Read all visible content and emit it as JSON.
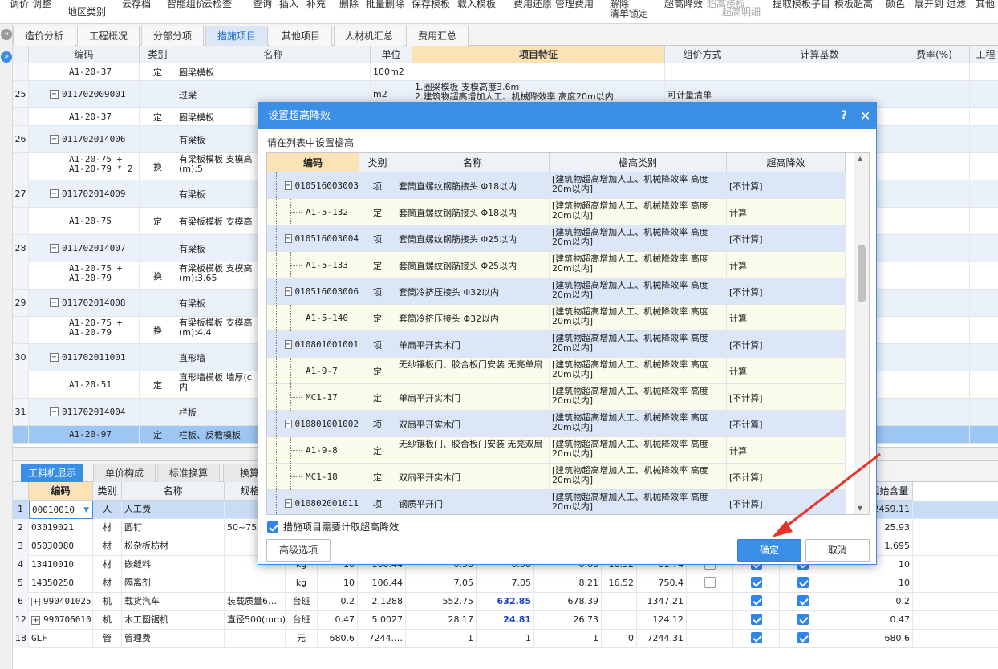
{
  "ribbon": {
    "items": [
      "调价",
      "调整",
      "地区类别",
      "云存档",
      "智能组价",
      "云检查",
      "查询",
      "插入",
      "补充",
      "删除",
      "批量删除",
      "保存模板",
      "载入模板",
      "费用还原",
      "管理费用",
      "解除",
      "清单锁定",
      "超高降效",
      "超高模板",
      "超高明细",
      "提取模板子目",
      "模板超高",
      "颜色",
      "展开到",
      "过滤",
      "其他"
    ]
  },
  "tabs": [
    "造价分析",
    "工程概况",
    "分部分项",
    "措施项目",
    "其他项目",
    "人材机汇总",
    "费用汇总"
  ],
  "activeTab": "措施项目",
  "grid": {
    "headers": [
      "编码",
      "类别",
      "名称",
      "单位",
      "项目特征",
      "组价方式",
      "计算基数",
      "费率(%)",
      "工程"
    ],
    "rows": [
      {
        "no": "",
        "code": "A1-20-37",
        "type": "定",
        "name": "圈梁模板",
        "unit": "100m2",
        "feature": "",
        "method": "",
        "level": "child"
      },
      {
        "no": "25",
        "code": "011702009001",
        "type": "",
        "name": "过梁",
        "unit": "m2",
        "feature": "1.圈梁模板 支模高度3.6m\n2.建筑物超高增加人工、机械降效率 高度20m以内",
        "method": "可计量清单",
        "level": "parent"
      },
      {
        "no": "",
        "code": "A1-20-37",
        "type": "定",
        "name": "圈梁模板",
        "unit": "",
        "feature": "",
        "method": "",
        "level": "child"
      },
      {
        "no": "26",
        "code": "011702014006",
        "type": "",
        "name": "有梁板",
        "unit": "",
        "feature": "",
        "method": "",
        "level": "parent"
      },
      {
        "no": "",
        "code": "A1-20-75 +\nA1-20-79 * 2",
        "type": "换",
        "name": "有梁板模板 支模高\n(m):5",
        "unit": "",
        "feature": "",
        "method": "",
        "level": "child"
      },
      {
        "no": "27",
        "code": "011702014009",
        "type": "",
        "name": "有梁板",
        "unit": "",
        "feature": "",
        "method": "",
        "level": "parent"
      },
      {
        "no": "",
        "code": "A1-20-75",
        "type": "定",
        "name": "有梁板模板 支模高",
        "unit": "",
        "feature": "",
        "method": "",
        "level": "child"
      },
      {
        "no": "28",
        "code": "011702014007",
        "type": "",
        "name": "有梁板",
        "unit": "",
        "feature": "",
        "method": "",
        "level": "parent"
      },
      {
        "no": "",
        "code": "A1-20-75 +\nA1-20-79",
        "type": "换",
        "name": "有梁板模板 支模高\n(m):3.65",
        "unit": "",
        "feature": "",
        "method": "",
        "level": "child"
      },
      {
        "no": "29",
        "code": "011702014008",
        "type": "",
        "name": "有梁板",
        "unit": "",
        "feature": "",
        "method": "",
        "level": "parent"
      },
      {
        "no": "",
        "code": "A1-20-75 +\nA1-20-79",
        "type": "换",
        "name": "有梁板模板 支模高\n(m):4.4",
        "unit": "",
        "feature": "",
        "method": "",
        "level": "child"
      },
      {
        "no": "30",
        "code": "011702011001",
        "type": "",
        "name": "直形墙",
        "unit": "",
        "feature": "",
        "method": "",
        "level": "parent"
      },
      {
        "no": "",
        "code": "A1-20-51",
        "type": "定",
        "name": "直形墙模板 墙厚(c\n内",
        "unit": "",
        "feature": "",
        "method": "",
        "level": "child"
      },
      {
        "no": "31",
        "code": "011702014004",
        "type": "",
        "name": "栏板",
        "unit": "",
        "feature": "",
        "method": "",
        "level": "parent"
      },
      {
        "no": "",
        "code": "A1-20-97",
        "type": "定",
        "name": "栏板、反檐模板",
        "unit": "",
        "feature": "",
        "method": "",
        "level": "selected"
      }
    ]
  },
  "bottomTabs": [
    "工料机显示",
    "单价构成",
    "标准换算",
    "换算信"
  ],
  "bottomGrid": {
    "headers": [
      "编码",
      "类别",
      "名称",
      "规格及",
      "",
      "",
      "",
      "",
      "",
      "",
      "",
      "",
      "",
      "",
      "",
      "规始含量"
    ],
    "rows": [
      {
        "no": "1",
        "code": "00010010",
        "type": "人",
        "name": "人工费",
        "spec": "",
        "unit": "",
        "q": "",
        "a": "",
        "p1": "",
        "p2": "",
        "p3": "",
        "p4": "",
        "p5": "",
        "c1": false,
        "c2": false,
        "c3": false,
        "last": "2459.11",
        "sel": true
      },
      {
        "no": "2",
        "code": "03019021",
        "type": "材",
        "name": "圆钉",
        "spec": "50~75",
        "unit": "",
        "q": "",
        "a": "",
        "p1": "",
        "p2": "",
        "p3": "",
        "p4": "",
        "p5": "",
        "c1": false,
        "c2": false,
        "c3": false,
        "last": "25.93"
      },
      {
        "no": "3",
        "code": "05030080",
        "type": "材",
        "name": "松杂板枋材",
        "spec": "",
        "unit": "",
        "q": "",
        "a": "",
        "p1": "",
        "p2": "",
        "p3": "",
        "p4": "",
        "p5": "",
        "c1": false,
        "c2": false,
        "c3": false,
        "last": "1.695"
      },
      {
        "no": "4",
        "code": "13410010",
        "type": "材",
        "name": "嵌缝料",
        "spec": "",
        "unit": "kg",
        "q": "10",
        "a": "106.44",
        "p1": "0.58",
        "p2": "0.58",
        "p3": "0.68",
        "p4": "16.52",
        "p5": "61.74",
        "c1": true,
        "c2": true,
        "c3": true,
        "last": "10"
      },
      {
        "no": "5",
        "code": "14350250",
        "type": "材",
        "name": "隔离剂",
        "spec": "",
        "unit": "kg",
        "q": "10",
        "a": "106.44",
        "p1": "7.05",
        "p2": "7.05",
        "p3": "8.21",
        "p4": "16.52",
        "p5": "750.4",
        "c1": true,
        "c2": true,
        "c3": true,
        "last": "10"
      },
      {
        "no": "6",
        "code": "990401025",
        "type": "机",
        "name": "载货汽车",
        "spec": "装载质量6…",
        "unit": "台班",
        "q": "0.2",
        "a": "2.1288",
        "p1": "552.75",
        "p2": "632.85",
        "p3": "678.39",
        "p4": "",
        "p5": "1347.21",
        "c1": false,
        "c2": true,
        "c3": true,
        "last": "0.2",
        "blue": true,
        "plus": true
      },
      {
        "no": "12",
        "code": "990706010",
        "type": "机",
        "name": "木工圆锯机",
        "spec": "直径500(mm)",
        "unit": "台班",
        "q": "0.47",
        "a": "5.0027",
        "p1": "28.17",
        "p2": "24.81",
        "p3": "26.73",
        "p4": "",
        "p5": "124.12",
        "c1": false,
        "c2": true,
        "c3": true,
        "last": "0.47",
        "blue": true,
        "plus": true
      },
      {
        "no": "18",
        "code": "GLF",
        "type": "管",
        "name": "管理费",
        "spec": "",
        "unit": "元",
        "q": "680.6",
        "a": "7244.…",
        "p1": "1",
        "p2": "1",
        "p3": "1",
        "p4": "0",
        "p5": "7244.31",
        "c1": false,
        "c2": true,
        "c3": true,
        "last": "680.6"
      }
    ]
  },
  "dialog": {
    "title": "设置超高降效",
    "help": "?",
    "close": "✕",
    "hint": "请在列表中设置檐高",
    "headers": [
      "编码",
      "类别",
      "名称",
      "檐高类别",
      "超高降效"
    ],
    "rows": [
      {
        "code": "010516003003",
        "type": "项",
        "name": "套筒直螺纹钢筋接头 Φ18以内",
        "cat": "[建筑物超高增加人工、机械降效率 高度20m以内]",
        "eff": "[不计算]",
        "kind": "p"
      },
      {
        "code": "A1-5-132",
        "type": "定",
        "name": "套筒直螺纹钢筋接头 Φ18以内",
        "cat": "[建筑物超高增加人工、机械降效率 高度20m以内]",
        "eff": "计算",
        "kind": "c"
      },
      {
        "code": "010516003004",
        "type": "项",
        "name": "套筒直螺纹钢筋接头 Φ25以内",
        "cat": "[建筑物超高增加人工、机械降效率 高度20m以内]",
        "eff": "[不计算]",
        "kind": "p"
      },
      {
        "code": "A1-5-133",
        "type": "定",
        "name": "套筒直螺纹钢筋接头 Φ25以内",
        "cat": "[建筑物超高增加人工、机械降效率 高度20m以内]",
        "eff": "计算",
        "kind": "c"
      },
      {
        "code": "010516003006",
        "type": "项",
        "name": "套筒冷挤压接头 Φ32以内",
        "cat": "[建筑物超高增加人工、机械降效率 高度20m以内]",
        "eff": "[不计算]",
        "kind": "p"
      },
      {
        "code": "A1-5-140",
        "type": "定",
        "name": "套筒冷挤压接头 Φ32以内",
        "cat": "[建筑物超高增加人工、机械降效率 高度20m以内]",
        "eff": "计算",
        "kind": "c"
      },
      {
        "code": "010801001001",
        "type": "项",
        "name": "单扇平开实木门",
        "cat": "[建筑物超高增加人工、机械降效率 高度20m以内]",
        "eff": "[不计算]",
        "kind": "p"
      },
      {
        "code": "A1-9-7",
        "type": "定",
        "name": "无纱镶板门、胶合板门安装 无亮单扇",
        "cat": "[建筑物超高增加人工、机械降效率 高度20m以内]",
        "eff": "计算",
        "kind": "c"
      },
      {
        "code": "MC1-17",
        "type": "定",
        "name": "单扇平开实木门",
        "cat": "[建筑物超高增加人工、机械降效率 高度20m以内]",
        "eff": "[不计算]",
        "kind": "c"
      },
      {
        "code": "010801001002",
        "type": "项",
        "name": "双扇平开实木门",
        "cat": "[建筑物超高增加人工、机械降效率 高度20m以内]",
        "eff": "[不计算]",
        "kind": "p"
      },
      {
        "code": "A1-9-8",
        "type": "定",
        "name": "无纱镶板门、胶合板门安装 无亮双扇",
        "cat": "[建筑物超高增加人工、机械降效率 高度20m以内]",
        "eff": "计算",
        "kind": "c"
      },
      {
        "code": "MC1-18",
        "type": "定",
        "name": "双扇平开实木门",
        "cat": "[建筑物超高增加人工、机械降效率 高度20m以内]",
        "eff": "[不计算]",
        "kind": "c"
      },
      {
        "code": "010802001011",
        "type": "项",
        "name": "钢质平开门",
        "cat": "[建筑物超高增加人工、机械降效率 高度20m以内]",
        "eff": "[不计算]",
        "kind": "p"
      }
    ],
    "checkbox_label": "措施项目需要计取超高降效",
    "checkbox_checked": true,
    "advanced_button": "高级选项",
    "ok_button": "确定",
    "cancel_button": "取消"
  },
  "colors": {
    "accent": "#3b8ee6",
    "arrow": "#e8322a",
    "selectedHeader": "#fbe3b6",
    "parentRow": "#dbe7f8",
    "childRow": "#fbfbec"
  }
}
